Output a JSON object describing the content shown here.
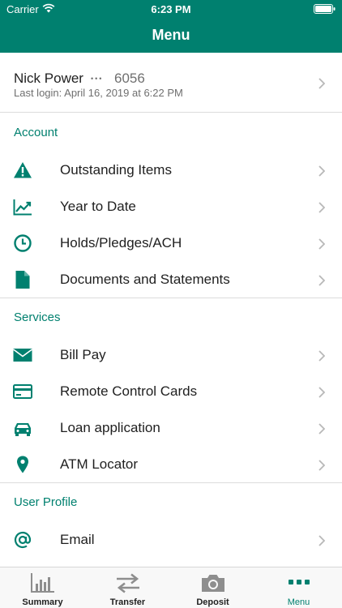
{
  "status_bar": {
    "carrier": "Carrier",
    "time": "6:23 PM"
  },
  "header": {
    "title": "Menu"
  },
  "profile": {
    "name": "Nick Power",
    "account_mask": "•••",
    "account_suffix": "6056",
    "last_login": "Last login: April 16, 2019 at 6:22 PM"
  },
  "sections": {
    "account": {
      "title": "Account",
      "items": [
        {
          "label": "Outstanding Items",
          "icon": "warning-icon"
        },
        {
          "label": "Year to Date",
          "icon": "trend-chart-icon"
        },
        {
          "label": "Holds/Pledges/ACH",
          "icon": "clock-icon"
        },
        {
          "label": "Documents and Statements",
          "icon": "document-icon"
        }
      ]
    },
    "services": {
      "title": "Services",
      "items": [
        {
          "label": "Bill Pay",
          "icon": "envelope-icon"
        },
        {
          "label": "Remote Control Cards",
          "icon": "credit-card-icon"
        },
        {
          "label": "Loan application",
          "icon": "car-icon"
        },
        {
          "label": "ATM Locator",
          "icon": "map-pin-icon"
        }
      ]
    },
    "user_profile": {
      "title": "User Profile",
      "items": [
        {
          "label": "Email",
          "icon": "at-sign-icon"
        }
      ]
    }
  },
  "tabbar": {
    "tabs": [
      {
        "label": "Summary",
        "icon": "bar-chart-icon"
      },
      {
        "label": "Transfer",
        "icon": "transfer-arrows-icon"
      },
      {
        "label": "Deposit",
        "icon": "camera-icon"
      },
      {
        "label": "Menu",
        "icon": "dots-menu-icon"
      }
    ],
    "active": "Menu"
  },
  "colors": {
    "accent": "#00806f",
    "text": "#1f1f1f",
    "muted": "#6f6f6f",
    "divider": "#dcdcdc",
    "tab_inactive": "#8e8e8e"
  }
}
